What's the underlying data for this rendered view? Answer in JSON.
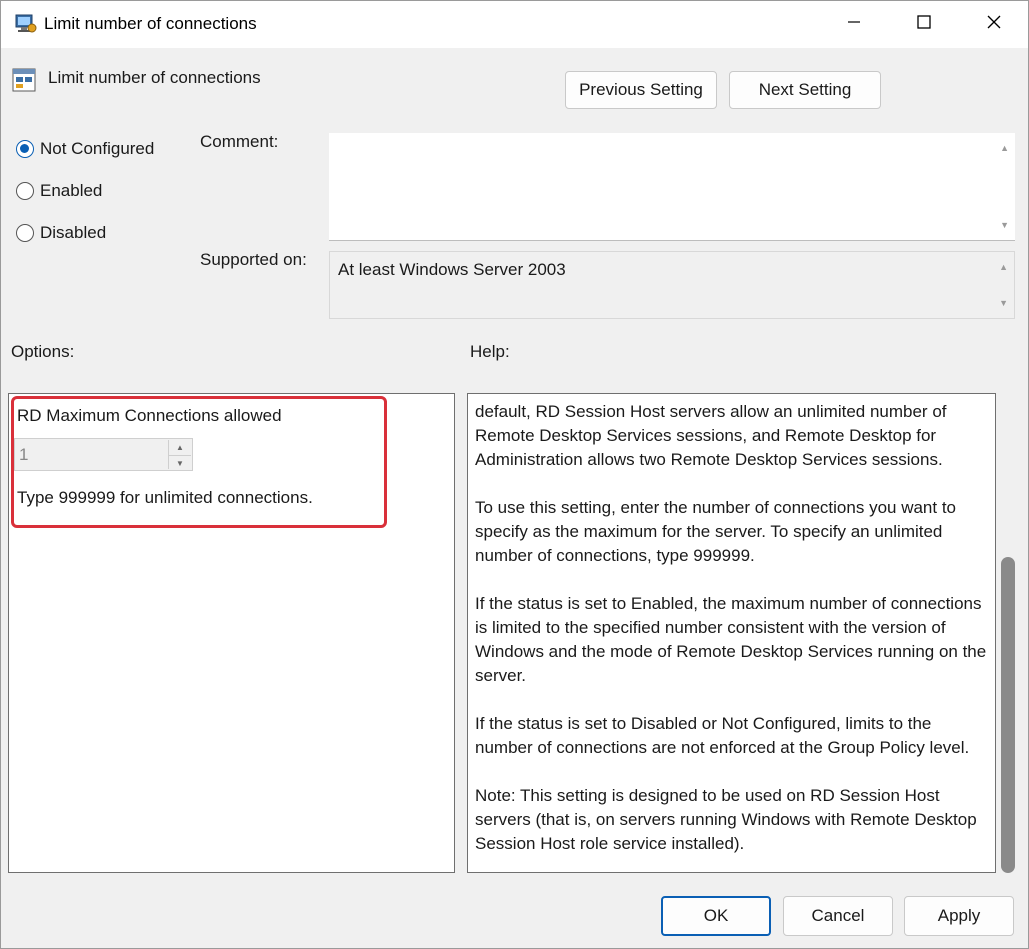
{
  "window": {
    "title": "Limit number of connections",
    "controls": {
      "minimize": "minimize",
      "maximize": "maximize",
      "close": "close"
    }
  },
  "header": {
    "title": "Limit number of connections",
    "previous_label": "Previous Setting",
    "next_label": "Next Setting"
  },
  "state": {
    "options": [
      {
        "label": "Not Configured",
        "checked": true
      },
      {
        "label": "Enabled",
        "checked": false
      },
      {
        "label": "Disabled",
        "checked": false
      }
    ]
  },
  "comment": {
    "label": "Comment:",
    "value": ""
  },
  "supported_on": {
    "label": "Supported on:",
    "value": "At least Windows Server 2003"
  },
  "options_section": {
    "label": "Options:",
    "max_connections_label": "RD Maximum Connections allowed",
    "max_connections_value": "1",
    "hint": "Type 999999 for unlimited connections."
  },
  "help_section": {
    "label": "Help:",
    "paragraphs": [
      "default, RD Session Host servers allow an unlimited number of Remote Desktop Services sessions, and Remote Desktop for Administration allows two Remote Desktop Services sessions.",
      "To use this setting, enter the number of connections you want to specify as the maximum for the server. To specify an unlimited number of connections, type 999999.",
      "If the status is set to Enabled, the maximum number of connections is limited to the specified number consistent with the version of Windows and the mode of Remote Desktop Services running on the server.",
      "If the status is set to Disabled or Not Configured, limits to the number of connections are not enforced at the Group Policy level.",
      "Note: This setting is designed to be used on RD Session Host servers (that is, on servers running Windows with Remote Desktop Session Host role service installed)."
    ]
  },
  "footer": {
    "ok_label": "OK",
    "cancel_label": "Cancel",
    "apply_label": "Apply"
  },
  "colors": {
    "accent": "#0a5fb4",
    "highlight": "#d9303a"
  }
}
